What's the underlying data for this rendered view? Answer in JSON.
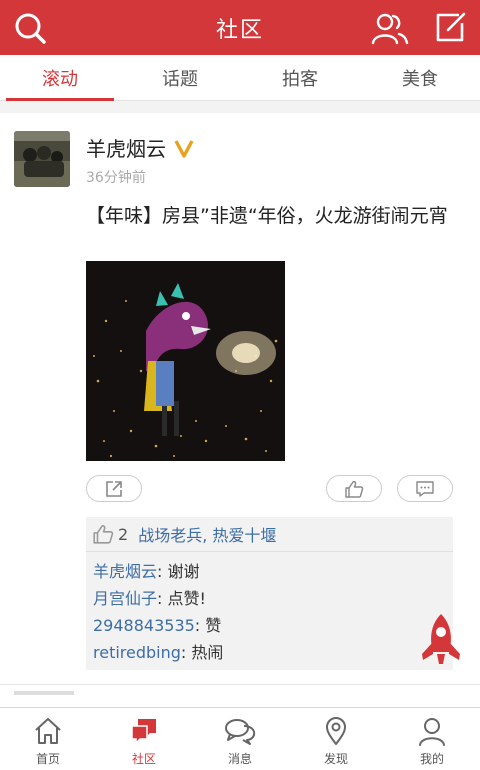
{
  "header": {
    "title": "社区",
    "left_icon": "search-icon",
    "right_icons": [
      "people-icon",
      "compose-icon"
    ],
    "bg_color": "#d4373a"
  },
  "tabs": [
    {
      "label": "滚动",
      "active": true
    },
    {
      "label": "话题",
      "active": false
    },
    {
      "label": "拍客",
      "active": false
    },
    {
      "label": "美食",
      "active": false
    }
  ],
  "post": {
    "author": "羊虎烟云",
    "verified_badge": "V",
    "time": "36分钟前",
    "title": "【年味】房县”非遗“年俗，火龙游街闹元宵",
    "likes_count": "2",
    "likers": "战场老兵, 热爱十堰",
    "comments": [
      {
        "name": "羊虎烟云",
        "sep": ": ",
        "text": "谢谢"
      },
      {
        "name": "月宫仙子",
        "sep": ": ",
        "text": "点赞!"
      },
      {
        "name": "2948843535",
        "sep": ": ",
        "text": "赞"
      },
      {
        "name": "retiredbing",
        "sep": ": ",
        "text": "热闹"
      }
    ]
  },
  "bottom_nav": [
    {
      "label": "首页",
      "icon": "home-icon",
      "active": false
    },
    {
      "label": "社区",
      "icon": "community-icon",
      "active": true
    },
    {
      "label": "消息",
      "icon": "message-icon",
      "active": false
    },
    {
      "label": "发现",
      "icon": "location-icon",
      "active": false
    },
    {
      "label": "我的",
      "icon": "profile-icon",
      "active": false
    }
  ],
  "colors": {
    "accent": "#d4373a",
    "link": "#3e6ea6",
    "verified": "#e8a21b"
  }
}
